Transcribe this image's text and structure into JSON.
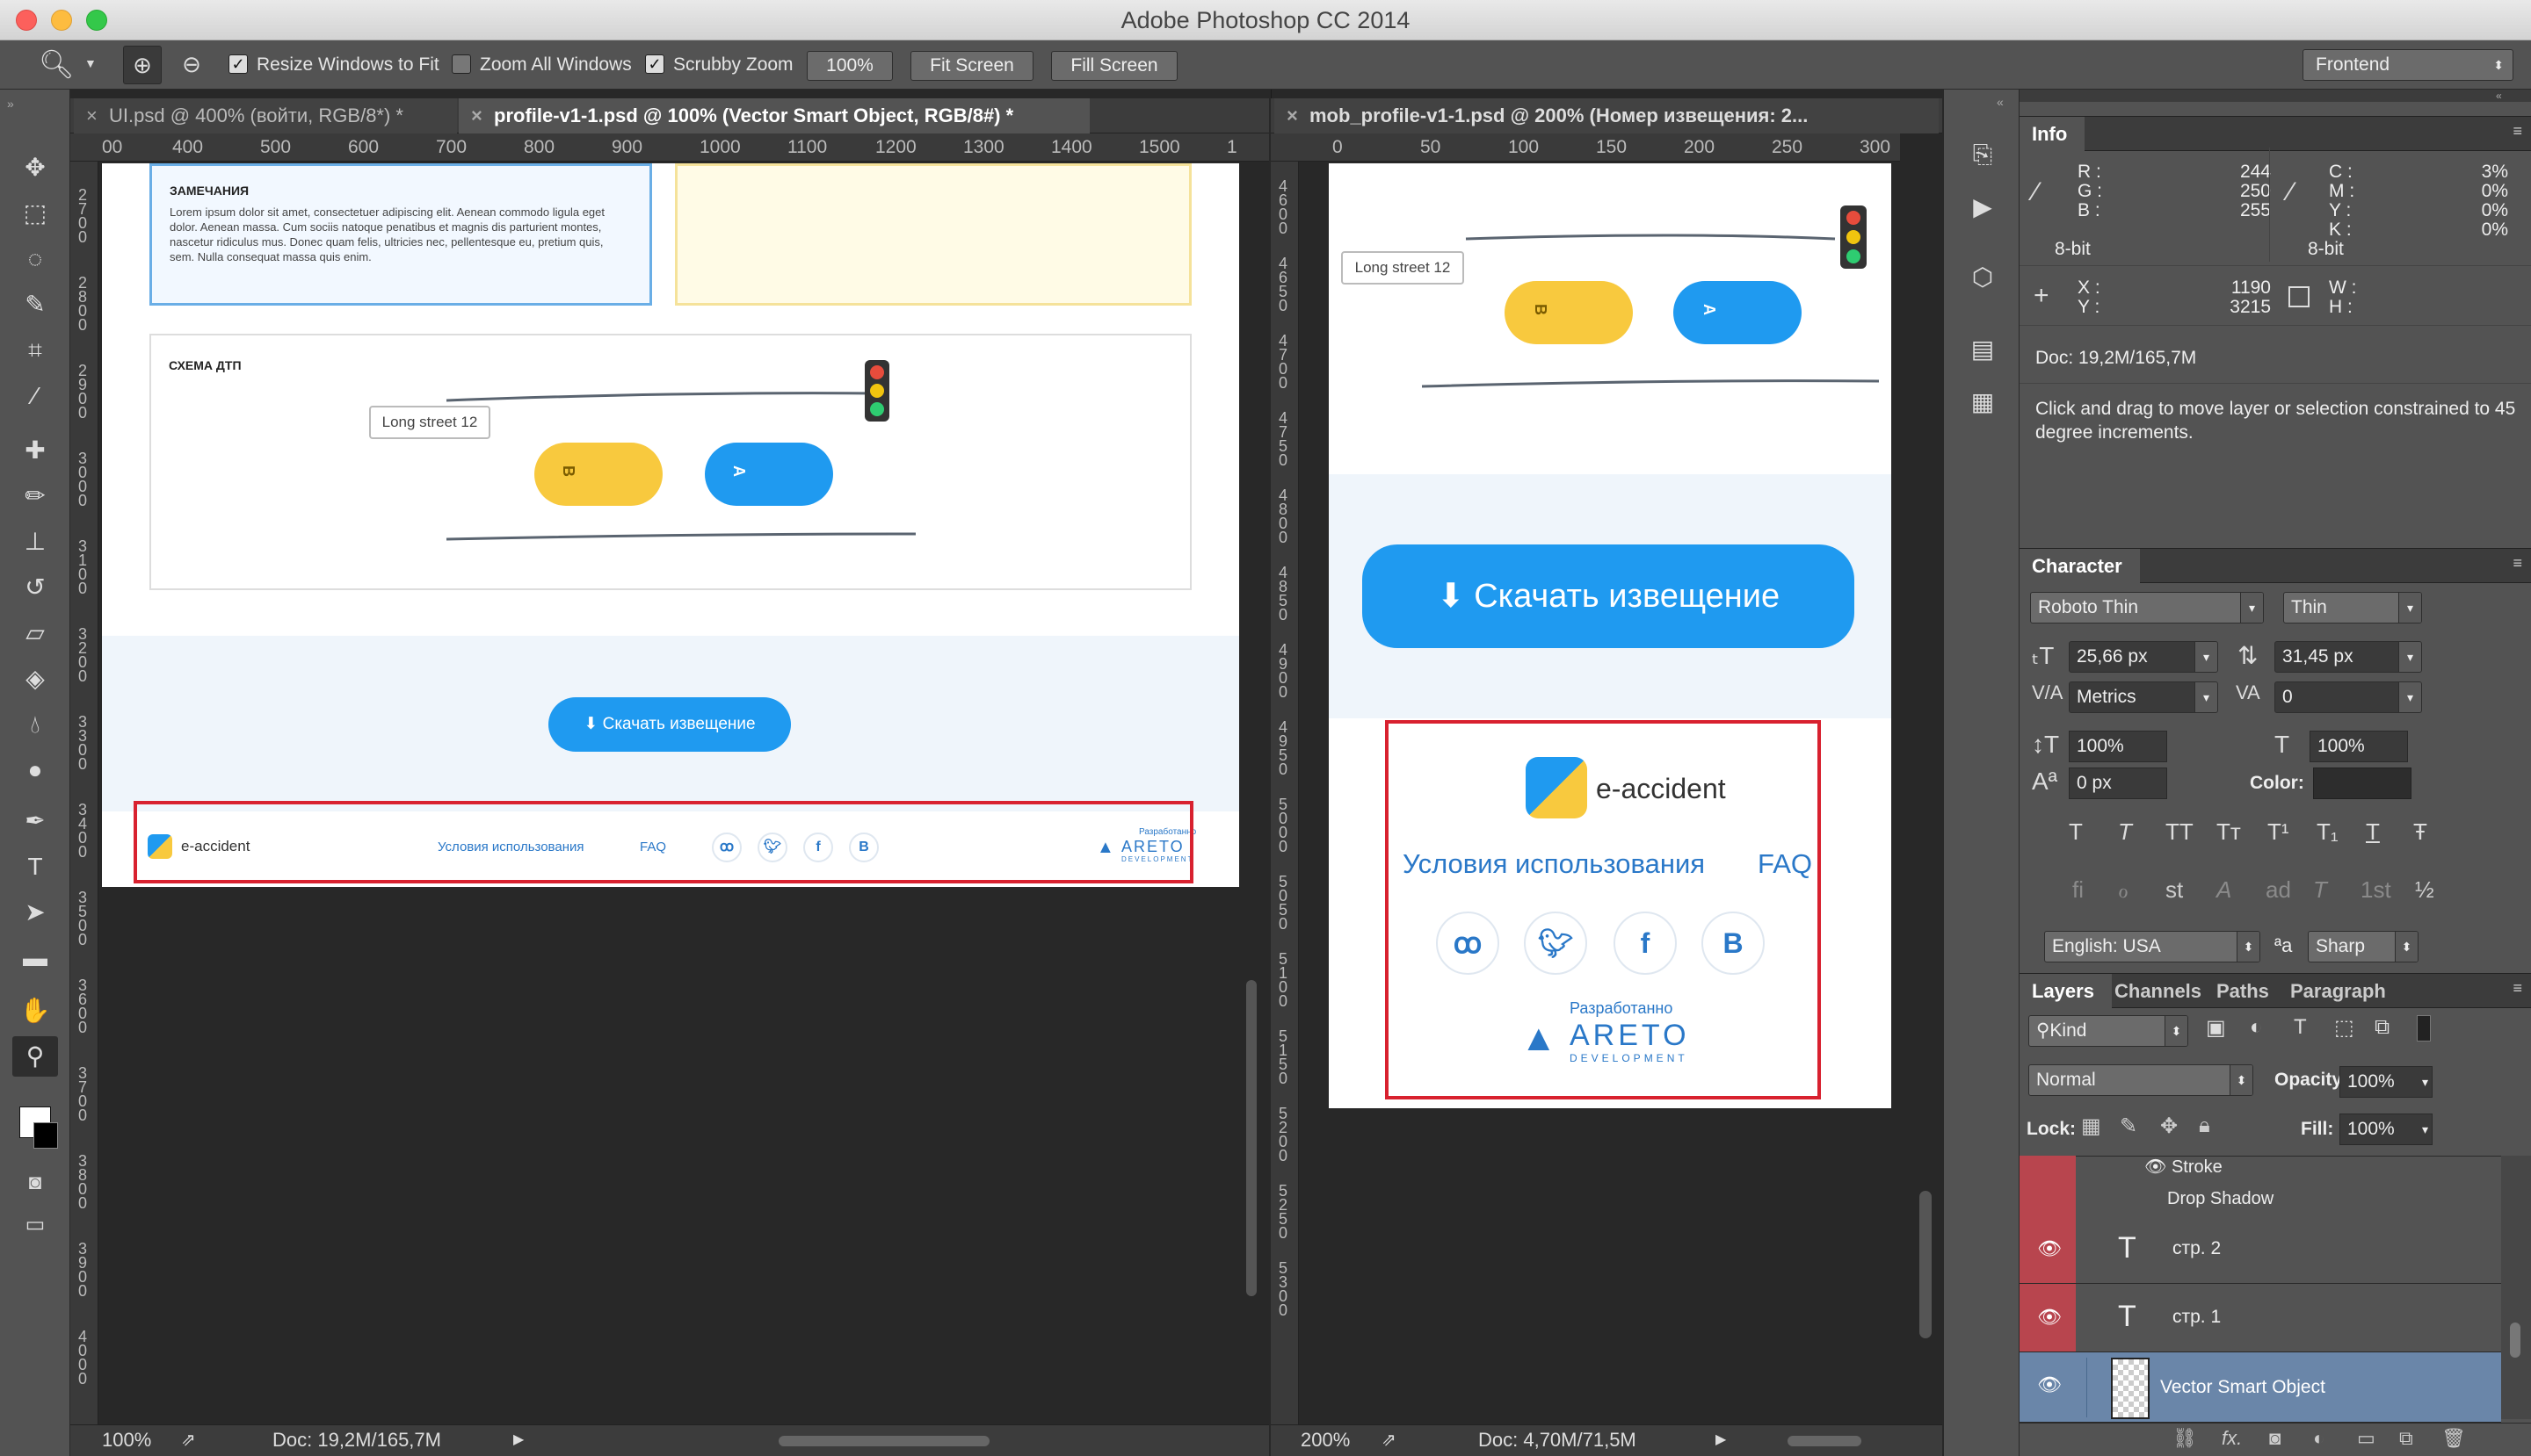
{
  "app": {
    "title": "Adobe Photoshop CC 2014"
  },
  "options_bar": {
    "resize_windows": "Resize Windows to Fit",
    "zoom_all": "Zoom All Windows",
    "scrubby_zoom": "Scrubby Zoom",
    "zoom_value": "100%",
    "fit_screen": "Fit Screen",
    "fill_screen": "Fill Screen",
    "workspace": "Frontend"
  },
  "doc_tabs": [
    {
      "label": "UI.psd @ 400% (войти, RGB/8*) *"
    },
    {
      "label": "profile-v1-1.psd @ 100% (Vector Smart Object, RGB/8#) *"
    },
    {
      "label": "mob_profile-v1-1.psd @ 200% (Номер извещения: 2..."
    }
  ],
  "left_doc": {
    "ruler_labels": [
      "00",
      "400",
      "500",
      "600",
      "700",
      "800",
      "900",
      "1000",
      "1100",
      "1200",
      "1300",
      "1400",
      "1500",
      "1"
    ],
    "vruler_labels": [
      "2700",
      "2800",
      "2900",
      "3000",
      "3100",
      "3200",
      "3300",
      "3400",
      "3500",
      "3600",
      "3700",
      "3800",
      "3900",
      "4000"
    ],
    "notes_title": "ЗАМЕЧАНИЯ",
    "notes_text": "Lorem ipsum dolor sit amet, consectetuer adipiscing elit. Aenean commodo ligula eget dolor. Aenean massa. Cum sociis natoque penatibus et magnis dis parturient montes, nascetur ridiculus mus. Donec quam felis, ultricies nec, pellentesque eu, pretium quis, sem. Nulla consequat massa quis enim.",
    "scheme_title": "СХЕМА ДТП",
    "street_label": "Long street 12",
    "car_b": "B",
    "car_a": "A",
    "download_button": "Скачать извещение",
    "footer": {
      "logo_text": "e-accident",
      "terms": "Условия использования",
      "faq": "FAQ",
      "social": [
        "ok",
        "twitter",
        "f",
        "B"
      ],
      "dev_label": "Разработанно",
      "dev_name": "ARETO",
      "dev_sub": "DEVELOPMENT"
    },
    "status": {
      "zoom": "100%",
      "doc": "Doc: 19,2M/165,7M"
    }
  },
  "right_doc": {
    "ruler_labels": [
      "0",
      "50",
      "100",
      "150",
      "200",
      "250",
      "300"
    ],
    "vruler_labels": [
      "4600",
      "4650",
      "4700",
      "4750",
      "4800",
      "4850",
      "4900",
      "4950",
      "5000",
      "5050",
      "5100",
      "5150",
      "5200",
      "5250",
      "5300"
    ],
    "street_label": "Long street 12",
    "car_b": "B",
    "car_a": "A",
    "download_button": "Скачать извещение",
    "footer": {
      "logo_text": "e-accident",
      "terms": "Условия использования",
      "faq": "FAQ",
      "social": [
        "ok",
        "twitter",
        "f",
        "B"
      ],
      "dev_label": "Разработанно",
      "dev_name": "ARETO",
      "dev_sub": "DEVELOPMENT"
    },
    "status": {
      "zoom": "200%",
      "doc": "Doc: 4,70M/71,5M"
    }
  },
  "info_panel": {
    "tab": "Info",
    "r_label": "R :",
    "r": "244",
    "g_label": "G :",
    "g": "250",
    "b_label": "B :",
    "b": "255",
    "c_label": "C :",
    "c": "3%",
    "m_label": "M :",
    "m": "0%",
    "y_label": "Y :",
    "y": "0%",
    "k_label": "K :",
    "k": "0%",
    "bit1": "8-bit",
    "bit2": "8-bit",
    "x_label": "X :",
    "x": "1190",
    "yy_label": "Y :",
    "yy": "3215",
    "w_label": "W :",
    "h_label": "H :",
    "doc": "Doc: 19,2M/165,7M",
    "hint": "Click and drag to move layer or selection constrained to 45 degree increments."
  },
  "character_panel": {
    "tab": "Character",
    "font": "Roboto Thin",
    "style": "Thin",
    "size": "25,66 px",
    "leading": "31,45 px",
    "kerning": "Metrics",
    "tracking": "0",
    "vscale": "100%",
    "hscale": "100%",
    "baseline": "0 px",
    "color_label": "Color:",
    "language": "English: USA",
    "aa_label": "ªa",
    "antialias": "Sharp",
    "style_glyphs": [
      "T",
      "T",
      "TT",
      "Tт",
      "T¹",
      "T₁",
      "T",
      "Ŧ"
    ],
    "ot_glyphs": [
      "fi",
      "ℴ",
      "st",
      "A",
      "ad",
      "T",
      "1st",
      "½"
    ]
  },
  "layers_panel": {
    "tabs": [
      "Layers",
      "Channels",
      "Paths",
      "Paragraph"
    ],
    "kind": "Kind",
    "blend": "Normal",
    "opacity_label": "Opacity:",
    "opacity": "100%",
    "lock_label": "Lock:",
    "fill_label": "Fill:",
    "fill": "100%",
    "effects": [
      "Stroke",
      "Drop Shadow"
    ],
    "layers": [
      {
        "name": "стр. 2"
      },
      {
        "name": "стр. 1"
      },
      {
        "name": "Vector Smart Object"
      }
    ]
  },
  "colors": {
    "accent_blue": "#1f9af0",
    "highlight_red": "#d8212f",
    "layer_selected": "#6a86a9",
    "eye_red": "#b8454e"
  }
}
